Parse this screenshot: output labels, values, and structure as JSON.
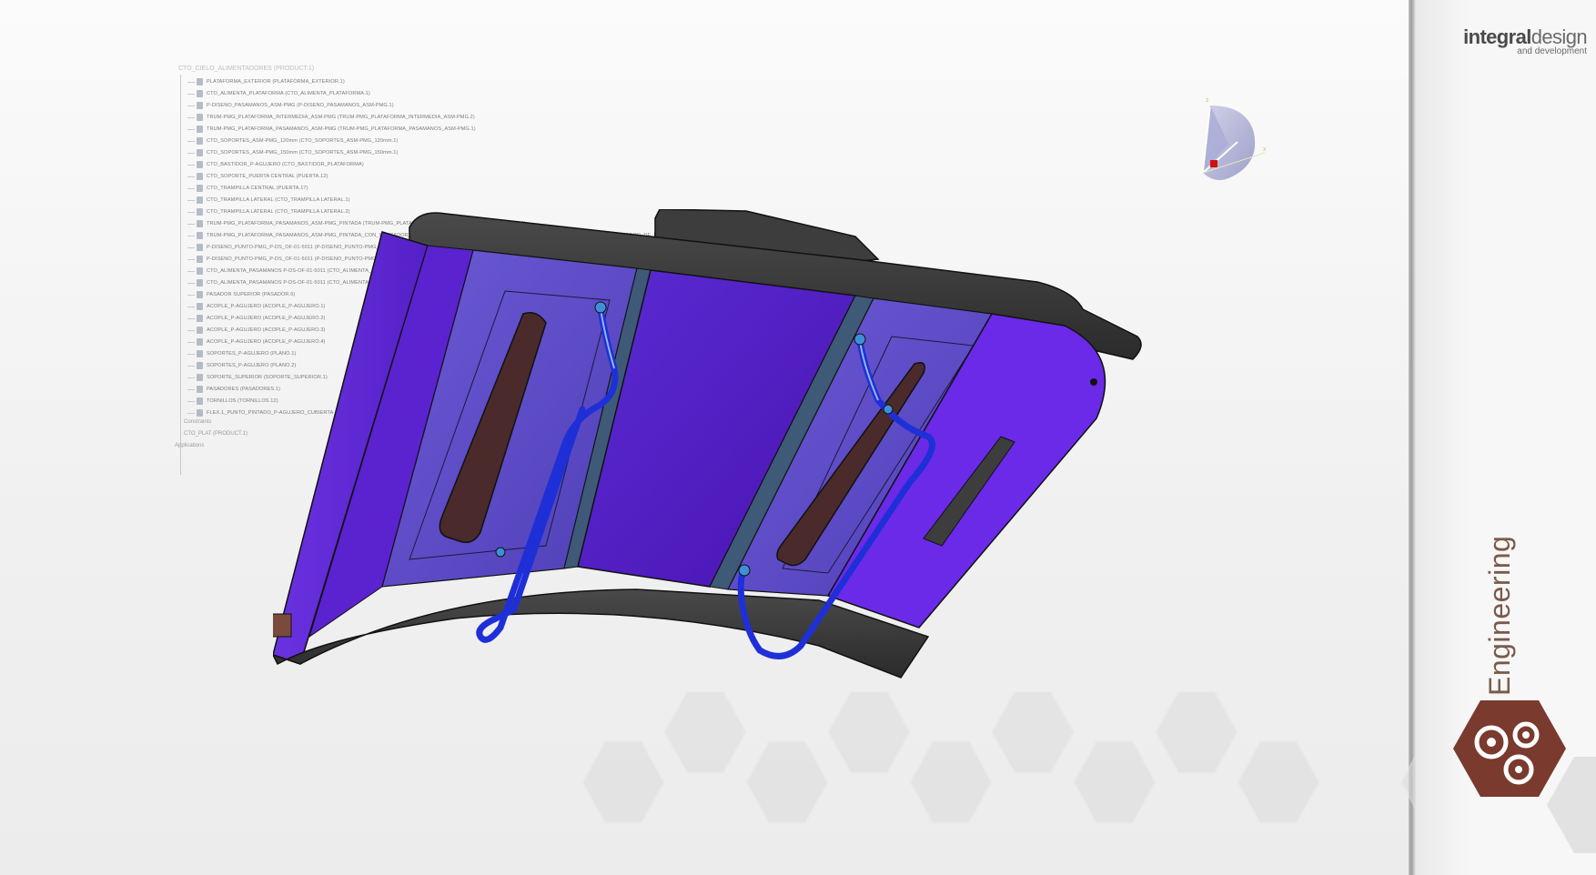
{
  "brand": {
    "name_bold": "integral",
    "name_light": "design",
    "tagline": "and development"
  },
  "section_label": "Engineering",
  "spec_tree": {
    "root": "CTO_CIELO_ALIMENTADORES (PRODUCT.1)",
    "nodes": [
      "PLATAFORMA_EXTERIOR (PLATAFORMA_EXTERIOR.1)",
      "CTO_ALIMENTA_PLATAFORMA (CTO_ALIMENTA_PLATAFORMA.1)",
      "P-DISENO_PASAMANOS_ASM-PMG (P-DISENO_PASAMANOS_ASM-PMG.1)",
      "TRUM-PMG_PLATAFORMA_INTERMEDIA_ASM-PMG (TRUM-PMG_PLATAFORMA_INTERMEDIA_ASM-PMG.2)",
      "TRUM-PMG_PLATAFORMA_PASAMANOS_ASM-PMG (TRUM-PMG_PLATAFORMA_PASAMANOS_ASM-PMG.1)",
      "CTO_SOPORTES_ASM-PMG_120mm (CTO_SOPORTES_ASM-PMG_120mm.1)",
      "CTO_SOPORTES_ASM-PMG_150mm (CTO_SOPORTES_ASM-PMG_150mm.1)",
      "CTO_BASTIDOR_P-AGUJERO (CTO_BASTIDOR_PLATAFORMA)",
      "CTO_SOPORTE_PUERTA CENTRAL (PUERTA.12)",
      "CTO_TRAMPILLA CENTRAL (PUERTA.17)",
      "CTO_TRAMPILLA LATERAL (CTO_TRAMPILLA LATERAL.1)",
      "CTO_TRAMPILLA LATERAL (CTO_TRAMPILLA LATERAL.2)",
      "TRUM-PMG_PLATAFORMA_PASAMANOS_ASM-PMG_PINTADA (TRUM-PMG_PLATAFORMA_PASAMANOS_ASM-PMG_PINTADA.1)",
      "TRUM-PMG_PLATAFORMA_PASAMANOS_ASM-PMG_PINTADA_CON_INDICADOR_DE_PASO (TRUM-PMG_PLATAFORMA_PASAMANOS_ASM-PMG_PINTADA_CON_INDICADOR_DE_PASO.1)",
      "P-DISENO_PUNTO-PMG_P-DS_OF-01-5011 (P-DISENO_PUNTO-PMG_P-DS_OF-01-5011.1)",
      "P-DISENO_PUNTO-PMG_P-DS_OF-01-5011 (P-DISENO_PUNTO-PMG_P-DS_OF-01-5011.2)",
      "CTO_ALIMENTA_PASAMANOS P-DS-OF-01-5011 (CTO_ALIMENTA_PASAMANOS P-DS-OF-01-5011.1)",
      "CTO_ALIMENTA_PASAMANOS P-DS-OF-01-5011 (CTO_ALIMENTA_PASAMANOS P-DS-OF-01-5011.2)",
      "PASADOR SUPERIOR (PASADOR.6)",
      "ACOPLE_P-AGUJERO (ACOPLE_P-AGUJERO.1)",
      "ACOPLE_P-AGUJERO (ACOPLE_P-AGUJERO.2)",
      "ACOPLE_P-AGUJERO (ACOPLE_P-AGUJERO.3)",
      "ACOPLE_P-AGUJERO (ACOPLE_P-AGUJERO.4)",
      "SOPORTES_P-AGUJERO (PLANO.1)",
      "SOPORTES_P-AGUJERO (PLANO.2)",
      "SOPORTE_SUPERIOR (SOPORTE_SUPERIOR.1)",
      "PASADORES (PASADORES.1)",
      "TORNILLOS (TORNILLOS.12)",
      "FLEX.1_PUNTO_PINTADO_P-AGUJERO_CUBIERTA",
      "Constraints",
      "CTO_PLAT (PRODUCT.1)",
      "Applications"
    ]
  }
}
